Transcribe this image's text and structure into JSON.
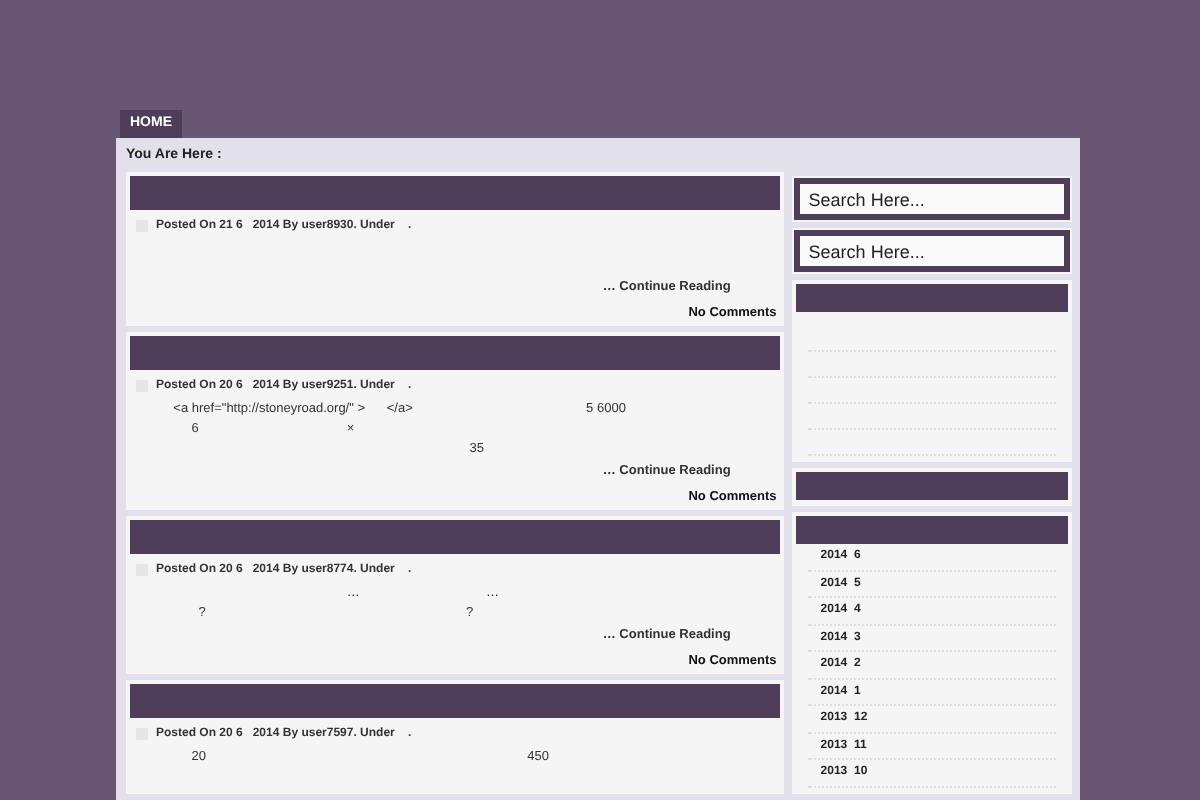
{
  "nav": [
    {
      "label": "HOME",
      "selected": true
    }
  ],
  "breadcrumb": "You Are Here :",
  "posts": [
    {
      "meta": "Posted On 21 6   2014 By user8930. Under    .",
      "more": "… Continue Reading",
      "comments": "No Comments"
    },
    {
      "meta": "Posted On 20 6   2014 By user9251. Under    .",
      "body": [
        "            <a href=\"http://stoneyroad.org/\" >      </a>                                                5 6000",
        "                 6                                         ×",
        "                                                                                              35"
      ],
      "more": "… Continue Reading",
      "comments": "No Comments"
    },
    {
      "meta": "Posted On 20 6   2014 By user8774. Under    .",
      "body": [
        "                                                            …                                   …",
        "                   ?                                                                        ?"
      ],
      "more": "… Continue Reading",
      "comments": "No Comments"
    },
    {
      "meta": "Posted On 20 6   2014 By user7597. Under    .",
      "body": [
        "                 20                                                                                         450"
      ]
    }
  ],
  "searches": [
    {
      "placeholder": "Search Here..."
    },
    {
      "placeholder": "Search Here..."
    }
  ],
  "archives": [
    "2014  6",
    "2014  5",
    "2014  4",
    "2014  3",
    "2014  2",
    "2014  1",
    "2013  12",
    "2013  11",
    "2013  10"
  ]
}
